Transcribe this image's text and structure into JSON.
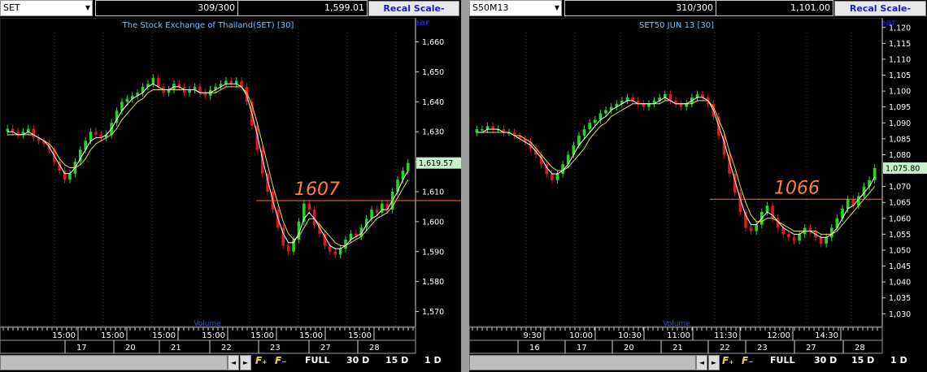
{
  "panes": [
    {
      "symbol": "SET",
      "bars_count": "309/300",
      "last_value": "1,599.01",
      "recal_label": "Recal Scale-Linear",
      "chart_title": "The Stock Exchange of Thailand(SET) [30]",
      "current_price_label": "1,619.57",
      "annotation_text": "1607",
      "volume_label": "Volume",
      "yticks": [
        "1,660",
        "1,650",
        "1,640",
        "1,630",
        "1,620",
        "1,610",
        "1,600",
        "1,590",
        "1,580",
        "1,570"
      ],
      "time_labels": [
        "15:00",
        "15:00",
        "15:00",
        "15:00",
        "15:00",
        "15:00",
        "15:00"
      ],
      "date_labels": [
        "17",
        "20",
        "21",
        "22",
        "23",
        "27",
        "28"
      ],
      "nav_prev": "◄",
      "nav_next": "►",
      "f_plus": "F₊",
      "f_minus": "F₋",
      "full": "FULL",
      "d30": "30 D",
      "d15": "15 D",
      "d1": "1 D"
    },
    {
      "symbol": "S50M13",
      "bars_count": "310/300",
      "last_value": "1,101.00",
      "recal_label": "Recal Scale-Linear",
      "chart_title": "SET50 JUN 13   [30]",
      "current_price_label": "1,075.80",
      "annotation_text": "1066",
      "volume_label": "Volume",
      "yticks": [
        "1,120",
        "1,115",
        "1,110",
        "1,105",
        "1,100",
        "1,095",
        "1,090",
        "1,085",
        "1,080",
        "1,075",
        "1,070",
        "1,065",
        "1,060",
        "1,055",
        "1,050",
        "1,045",
        "1,040",
        "1,035",
        "1,030"
      ],
      "time_labels": [
        "9:30",
        "10:00",
        "10:30",
        "11:00",
        "11:30",
        "12:00",
        "14:30"
      ],
      "date_labels": [
        "16",
        "17",
        "20",
        "21",
        "22",
        "23",
        "27",
        "28"
      ],
      "nav_prev": "◄",
      "nav_next": "►",
      "f_plus": "F₊",
      "f_minus": "F₋",
      "full": "FULL",
      "d30": "30 D",
      "d15": "15 D",
      "d1": "1 D"
    }
  ],
  "colors": {
    "up": "#26d626",
    "down": "#e01818",
    "ma1": "#ffffff",
    "ma2": "#e8e040",
    "annotation": "#ff7f3f",
    "hline": "#ff6a2a",
    "price_tag_bg": "#c8f0c8",
    "date_axis": "#ffffff"
  },
  "chart_data": [
    {
      "type": "candlestick",
      "title": "The Stock Exchange of Thailand(SET) [30]",
      "ylim": [
        1565,
        1668
      ],
      "yticks": [
        1660,
        1650,
        1640,
        1630,
        1620,
        1610,
        1600,
        1590,
        1580,
        1570
      ],
      "hline_value": 1607,
      "last_price": 1619.57,
      "close": [
        1631,
        1630,
        1629,
        1630,
        1631,
        1628,
        1627,
        1626,
        1624,
        1620,
        1617,
        1614,
        1616,
        1620,
        1624,
        1627,
        1630,
        1629,
        1628,
        1629,
        1633,
        1637,
        1640,
        1641,
        1642,
        1643,
        1645,
        1646,
        1648,
        1645,
        1643,
        1644,
        1646,
        1645,
        1643,
        1644,
        1645,
        1643,
        1642,
        1644,
        1645,
        1646,
        1647,
        1646,
        1647,
        1645,
        1640,
        1632,
        1624,
        1616,
        1610,
        1604,
        1598,
        1592,
        1590,
        1594,
        1600,
        1606,
        1604,
        1599,
        1596,
        1592,
        1590,
        1589,
        1591,
        1594,
        1596,
        1595,
        1598,
        1601,
        1604,
        1603,
        1606,
        1604,
        1610,
        1614,
        1617,
        1619.57
      ],
      "ma_fast": [
        1630,
        1630,
        1629,
        1629,
        1630,
        1629,
        1628,
        1627,
        1625,
        1622,
        1619,
        1616,
        1616,
        1618,
        1621,
        1624,
        1627,
        1628,
        1628,
        1629,
        1631,
        1634,
        1637,
        1639,
        1641,
        1642,
        1643,
        1645,
        1646,
        1645,
        1644,
        1644,
        1645,
        1645,
        1644,
        1644,
        1644,
        1643,
        1643,
        1643,
        1644,
        1645,
        1646,
        1646,
        1646,
        1645,
        1642,
        1636,
        1629,
        1621,
        1614,
        1607,
        1601,
        1596,
        1593,
        1593,
        1596,
        1601,
        1603,
        1601,
        1598,
        1595,
        1592,
        1591,
        1591,
        1592,
        1594,
        1595,
        1596,
        1599,
        1601,
        1602,
        1604,
        1604,
        1607,
        1610,
        1614,
        1617
      ],
      "ma_slow": [
        1629,
        1629,
        1629,
        1629,
        1629,
        1629,
        1628,
        1627,
        1626,
        1624,
        1621,
        1619,
        1618,
        1618,
        1619,
        1621,
        1624,
        1626,
        1627,
        1628,
        1629,
        1631,
        1634,
        1636,
        1638,
        1640,
        1641,
        1643,
        1644,
        1644,
        1644,
        1644,
        1644,
        1644,
        1644,
        1644,
        1644,
        1643,
        1643,
        1643,
        1643,
        1644,
        1645,
        1645,
        1645,
        1645,
        1643,
        1639,
        1633,
        1626,
        1619,
        1612,
        1606,
        1600,
        1596,
        1594,
        1595,
        1598,
        1601,
        1601,
        1599,
        1597,
        1595,
        1593,
        1592,
        1592,
        1593,
        1594,
        1595,
        1597,
        1599,
        1601,
        1602,
        1603,
        1605,
        1608,
        1611,
        1614
      ]
    },
    {
      "type": "candlestick",
      "title": "SET50 JUN 13   [30]",
      "ylim": [
        1026,
        1123
      ],
      "yticks": [
        1120,
        1115,
        1110,
        1105,
        1100,
        1095,
        1090,
        1085,
        1080,
        1075,
        1070,
        1065,
        1060,
        1055,
        1050,
        1045,
        1040,
        1035,
        1030
      ],
      "hline_value": 1066,
      "last_price": 1075.8,
      "close": [
        1088,
        1088,
        1089,
        1088,
        1088,
        1087,
        1087,
        1086,
        1085,
        1084,
        1082,
        1080,
        1077,
        1074,
        1072,
        1074,
        1077,
        1080,
        1083,
        1086,
        1088,
        1090,
        1091,
        1093,
        1094,
        1095,
        1096,
        1097,
        1098,
        1097,
        1096,
        1095,
        1096,
        1097,
        1098,
        1099,
        1097,
        1096,
        1095,
        1096,
        1098,
        1099,
        1098,
        1096,
        1092,
        1086,
        1080,
        1074,
        1068,
        1062,
        1057,
        1056,
        1058,
        1062,
        1064,
        1060,
        1057,
        1055,
        1054,
        1053,
        1055,
        1057,
        1056,
        1054,
        1052,
        1054,
        1057,
        1060,
        1063,
        1066,
        1064,
        1067,
        1070,
        1072,
        1075.8
      ],
      "ma_fast": [
        1087,
        1087,
        1088,
        1088,
        1088,
        1087,
        1087,
        1086,
        1085,
        1084,
        1083,
        1081,
        1079,
        1076,
        1074,
        1074,
        1075,
        1077,
        1080,
        1083,
        1085,
        1087,
        1089,
        1091,
        1092,
        1094,
        1095,
        1096,
        1097,
        1097,
        1096,
        1096,
        1096,
        1096,
        1097,
        1098,
        1097,
        1096,
        1096,
        1096,
        1097,
        1098,
        1098,
        1097,
        1094,
        1089,
        1084,
        1078,
        1072,
        1066,
        1061,
        1058,
        1058,
        1060,
        1062,
        1061,
        1059,
        1057,
        1056,
        1055,
        1055,
        1056,
        1056,
        1055,
        1054,
        1054,
        1055,
        1057,
        1060,
        1063,
        1064,
        1066,
        1068,
        1070,
        1073
      ],
      "ma_slow": [
        1087,
        1087,
        1087,
        1087,
        1087,
        1087,
        1087,
        1086,
        1086,
        1085,
        1084,
        1082,
        1080,
        1078,
        1076,
        1075,
        1075,
        1076,
        1078,
        1080,
        1082,
        1085,
        1087,
        1089,
        1090,
        1092,
        1093,
        1094,
        1095,
        1096,
        1096,
        1096,
        1096,
        1096,
        1096,
        1097,
        1097,
        1096,
        1096,
        1096,
        1096,
        1097,
        1097,
        1097,
        1095,
        1091,
        1087,
        1081,
        1076,
        1070,
        1065,
        1061,
        1059,
        1059,
        1060,
        1060,
        1059,
        1058,
        1057,
        1056,
        1056,
        1056,
        1056,
        1056,
        1055,
        1055,
        1055,
        1056,
        1058,
        1060,
        1062,
        1064,
        1066,
        1068,
        1070
      ]
    }
  ]
}
